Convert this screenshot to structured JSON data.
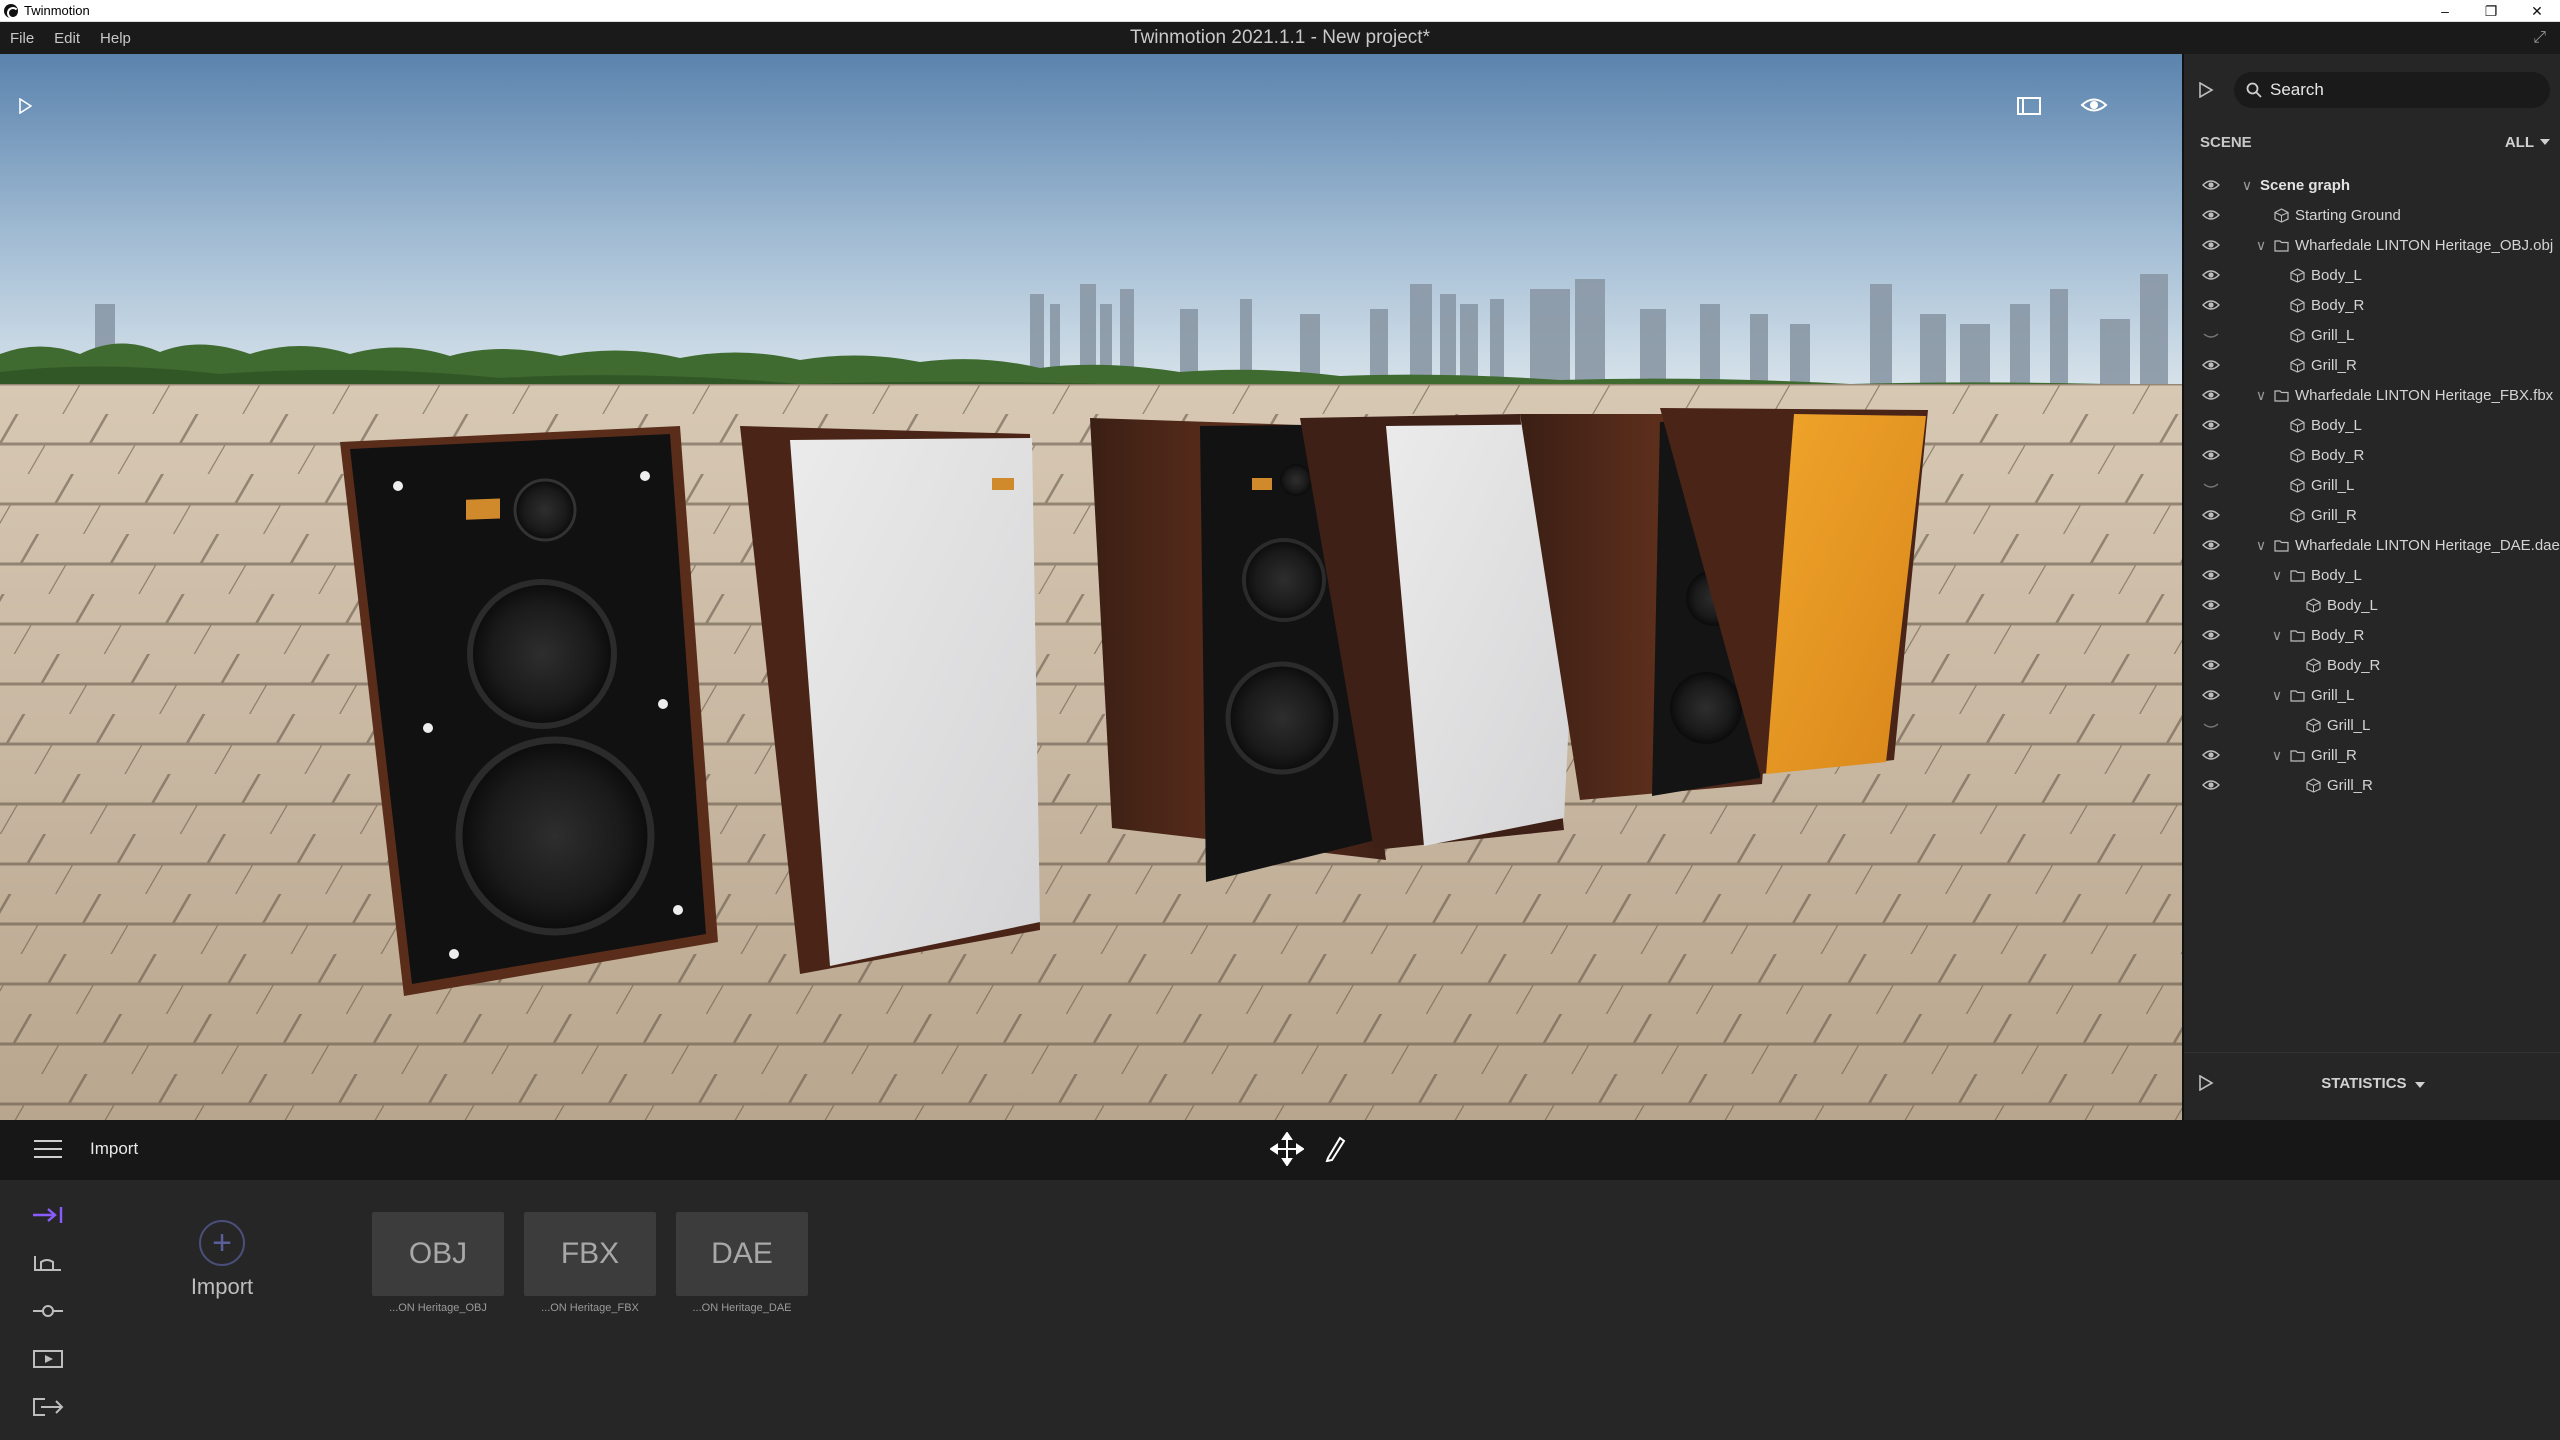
{
  "os_window": {
    "title": "Twinmotion",
    "controls": [
      "–",
      "❐",
      "✕"
    ]
  },
  "menubar": {
    "items": [
      "File",
      "Edit",
      "Help"
    ],
    "document_title": "Twinmotion 2021.1.1 - New project*"
  },
  "right_panel": {
    "search_placeholder": "Search",
    "scene_label": "SCENE",
    "filter_label": "ALL",
    "tree": [
      {
        "label": "Scene graph",
        "depth": 0,
        "kind": "root",
        "expanded": true,
        "visible": true
      },
      {
        "label": "Starting Ground",
        "depth": 1,
        "kind": "object",
        "visible": true
      },
      {
        "label": "Wharfedale LINTON Heritage_OBJ.obj",
        "depth": 1,
        "kind": "folder",
        "expanded": true,
        "visible": true
      },
      {
        "label": "Body_L",
        "depth": 2,
        "kind": "object",
        "visible": true
      },
      {
        "label": "Body_R",
        "depth": 2,
        "kind": "object",
        "visible": true
      },
      {
        "label": "Grill_L",
        "depth": 2,
        "kind": "object",
        "visible": false
      },
      {
        "label": "Grill_R",
        "depth": 2,
        "kind": "object",
        "visible": true
      },
      {
        "label": "Wharfedale LINTON Heritage_FBX.fbx",
        "depth": 1,
        "kind": "folder",
        "expanded": true,
        "visible": true
      },
      {
        "label": "Body_L",
        "depth": 2,
        "kind": "object",
        "visible": true
      },
      {
        "label": "Body_R",
        "depth": 2,
        "kind": "object",
        "visible": true
      },
      {
        "label": "Grill_L",
        "depth": 2,
        "kind": "object",
        "visible": false
      },
      {
        "label": "Grill_R",
        "depth": 2,
        "kind": "object",
        "visible": true
      },
      {
        "label": "Wharfedale LINTON Heritage_DAE.dae",
        "depth": 1,
        "kind": "folder",
        "expanded": true,
        "visible": true
      },
      {
        "label": "Body_L",
        "depth": 2,
        "kind": "folder",
        "expanded": true,
        "visible": true
      },
      {
        "label": "Body_L",
        "depth": 3,
        "kind": "object",
        "visible": true
      },
      {
        "label": "Body_R",
        "depth": 2,
        "kind": "folder",
        "expanded": true,
        "visible": true
      },
      {
        "label": "Body_R",
        "depth": 3,
        "kind": "object",
        "visible": true
      },
      {
        "label": "Grill_L",
        "depth": 2,
        "kind": "folder",
        "expanded": true,
        "visible": true
      },
      {
        "label": "Grill_L",
        "depth": 3,
        "kind": "object",
        "visible": false
      },
      {
        "label": "Grill_R",
        "depth": 2,
        "kind": "folder",
        "expanded": true,
        "visible": true
      },
      {
        "label": "Grill_R",
        "depth": 3,
        "kind": "object",
        "visible": true
      }
    ],
    "statistics_label": "STATISTICS"
  },
  "bottom_toolbar": {
    "section_title": "Import"
  },
  "bottom_panel": {
    "import_label": "Import",
    "side_tabs": [
      "import-tab",
      "context-tab",
      "configure-tab",
      "media-tab",
      "export-tab"
    ],
    "assets": [
      {
        "format": "OBJ",
        "caption": "...ON Heritage_OBJ"
      },
      {
        "format": "FBX",
        "caption": "...ON Heritage_FBX"
      },
      {
        "format": "DAE",
        "caption": "...ON Heritage_DAE"
      }
    ]
  },
  "colors": {
    "accent": "#7b5cff",
    "panel_bg": "#262626",
    "toolbar_bg": "#171717"
  }
}
